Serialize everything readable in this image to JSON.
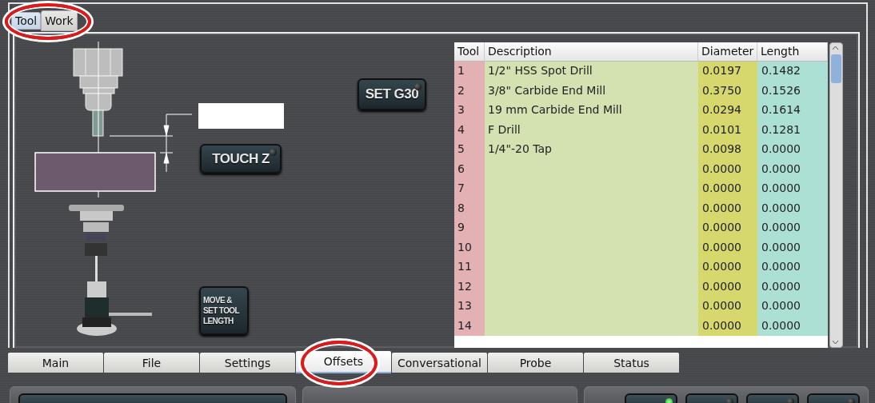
{
  "tool_tabs": {
    "circled": true,
    "tabs": [
      {
        "label": "Tool",
        "selected": true
      },
      {
        "label": "Work",
        "selected": false
      }
    ]
  },
  "buttons": [
    {
      "kind": "set_g30",
      "label": "SET G30",
      "lit": false
    },
    {
      "kind": "touch_z",
      "label": "TOUCH Z",
      "lit": false
    },
    {
      "kind": "move_set",
      "label": "MOVE & SET TOOL LENGTH"
    }
  ],
  "table": {
    "columns": [
      "Tool",
      "Description",
      "Diameter",
      "Length"
    ],
    "rows": [
      [
        "1",
        "1/2\" HSS Spot Drill",
        "0.0197",
        "0.1482"
      ],
      [
        "2",
        "3/8\" Carbide End Mill",
        "0.3750",
        "0.1526"
      ],
      [
        "3",
        "19 mm Carbide End Mill",
        "0.0294",
        "0.1614"
      ],
      [
        "4",
        "F Drill",
        "0.0101",
        "0.1281"
      ],
      [
        "5",
        "1/4\"-20 Tap",
        "0.0098",
        "0.0000"
      ],
      [
        "6",
        "",
        "0.0000",
        "0.0000"
      ],
      [
        "7",
        "",
        "0.0000",
        "0.0000"
      ],
      [
        "8",
        "",
        "0.0000",
        "0.0000"
      ],
      [
        "9",
        "",
        "0.0000",
        "0.0000"
      ],
      [
        "10",
        "",
        "0.0000",
        "0.0000"
      ],
      [
        "11",
        "",
        "0.0000",
        "0.0000"
      ],
      [
        "12",
        "",
        "0.0000",
        "0.0000"
      ],
      [
        "13",
        "",
        "0.0000",
        "0.0000"
      ],
      [
        "14",
        "",
        "0.0000",
        "0.0000"
      ]
    ]
  },
  "main_tabs": [
    {
      "label": "Main",
      "selected": false,
      "circled": false
    },
    {
      "label": "File",
      "selected": false,
      "circled": false
    },
    {
      "label": "Settings",
      "selected": false,
      "circled": false
    },
    {
      "label": "Offsets",
      "selected": true,
      "circled": true
    },
    {
      "label": "Conversational",
      "selected": false,
      "circled": false
    },
    {
      "label": "Probe",
      "selected": false,
      "circled": false
    },
    {
      "label": "Status",
      "selected": false,
      "circled": false
    }
  ],
  "bottom_buttons": [
    {
      "lit": true
    },
    {
      "lit": false
    },
    {
      "lit": false
    },
    {
      "lit": false
    }
  ]
}
